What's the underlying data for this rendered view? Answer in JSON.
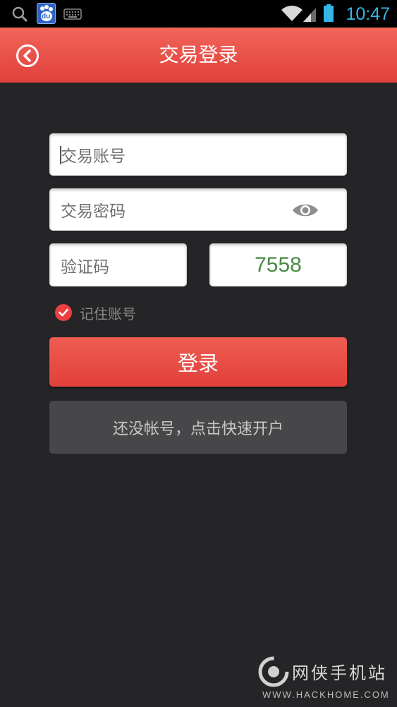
{
  "status_bar": {
    "time": "10:47",
    "baidu_text": "du",
    "icons": [
      "search-icon",
      "baidu-app-icon",
      "keyboard-icon",
      "wifi-icon",
      "signal-icon",
      "battery-icon"
    ]
  },
  "header": {
    "title": "交易登录",
    "back_icon": "back-arrow-circle-icon",
    "colors": {
      "background": "#e8493f",
      "text": "#ffffff"
    }
  },
  "form": {
    "account_placeholder": "交易账号",
    "password_placeholder": "交易密码",
    "password_toggle_icon": "eye-icon",
    "captcha_placeholder": "验证码",
    "captcha_code": "7558",
    "remember": {
      "label": "记住账号",
      "checked": true
    }
  },
  "buttons": {
    "login_label": "登录",
    "register_label": "还没帐号，点击快速开户"
  },
  "watermark": {
    "name": "网侠手机站",
    "url": "WWW.HACKHOME.COM"
  },
  "colors": {
    "background": "#252527",
    "accent": "#e8493f",
    "code_text": "#4a8a44",
    "secondary_button": "#474749",
    "status_time": "#33b5e5"
  }
}
